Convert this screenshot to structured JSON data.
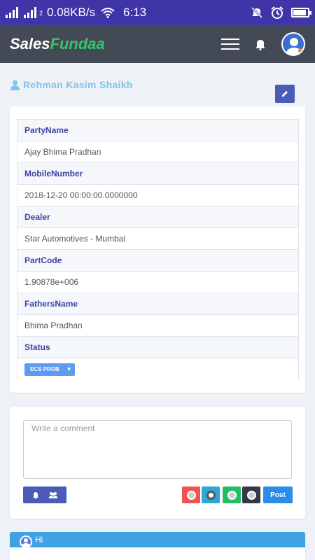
{
  "statusbar": {
    "network_speed": "0.08KB/s",
    "sim_indicator": "2",
    "time": "6:13",
    "icons": [
      "signal-icon",
      "signal-icon",
      "wifi-icon",
      "mute-icon",
      "alarm-icon",
      "battery-icon"
    ]
  },
  "navbar": {
    "brand_part1": "Sales",
    "brand_part2": "Fundaa",
    "icons": [
      "menu-icon",
      "bell-icon",
      "avatar"
    ]
  },
  "profile": {
    "name": "Rehman Kasim Shaikh"
  },
  "details": {
    "fields": [
      {
        "label": "PartyName",
        "value": "Ajay Bhima Pradhan"
      },
      {
        "label": "MobileNumber",
        "value": "2018-12-20 00:00:00.0000000"
      },
      {
        "label": "Dealer",
        "value": "Star Automotives - Mumbai"
      },
      {
        "label": "PartCode",
        "value": "1.90878e+006"
      },
      {
        "label": "FathersName",
        "value": "Bhima Pradhan"
      }
    ],
    "status_label": "Status",
    "status_value": "ECS PROB"
  },
  "comment": {
    "placeholder": "Write a comment",
    "post_label": "Post",
    "colors": [
      "#ef5454",
      "#2ea6d8",
      "#1fbd66",
      "#333a45"
    ],
    "selected_color_index": 1
  },
  "feed": {
    "first_message": "Hi"
  },
  "colors": {
    "statusbar": "#3f35a8",
    "navbar": "#434a56",
    "accent": "#4b5bb8",
    "brand_green": "#36c46a"
  }
}
